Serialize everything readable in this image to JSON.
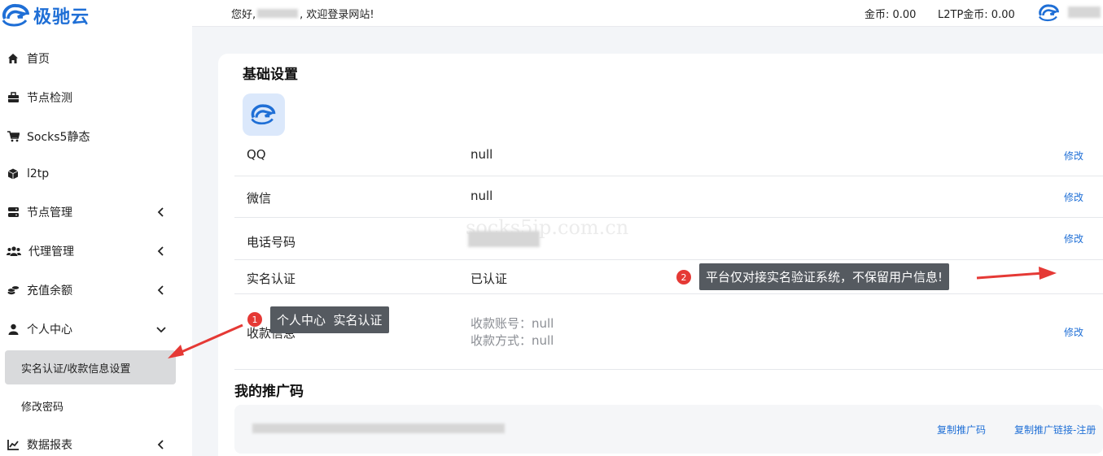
{
  "brand": {
    "name": "极驰云",
    "accent": "#1f6fd6"
  },
  "header": {
    "greeting_prefix": "您好,",
    "greeting_suffix": ", 欢迎登录网站!",
    "gold_label": "金币: 0.00",
    "l2tp_gold_label": "L2TP金币: 0.00"
  },
  "sidebar": {
    "items": [
      {
        "label": "首页",
        "icon": "home-icon"
      },
      {
        "label": "节点检测",
        "icon": "briefcase-icon"
      },
      {
        "label": "Socks5静态",
        "icon": "cart-icon"
      },
      {
        "label": "l2tp",
        "icon": "cube-icon"
      },
      {
        "label": "节点管理",
        "icon": "server-icon"
      },
      {
        "label": "代理管理",
        "icon": "users-icon"
      },
      {
        "label": "充值余额",
        "icon": "coins-icon"
      },
      {
        "label": "个人中心",
        "icon": "user-icon"
      },
      {
        "label": "数据报表",
        "icon": "chart-icon"
      }
    ],
    "sub_items": [
      {
        "label": "实名认证/收款信息设置",
        "active": true
      },
      {
        "label": "修改密码",
        "active": false
      }
    ]
  },
  "main": {
    "basic_title": "基础设置",
    "rows": [
      {
        "label": "QQ",
        "value": "null",
        "action": "修改"
      },
      {
        "label": "微信",
        "value": "null",
        "action": "修改"
      },
      {
        "label": "电话号码",
        "value": "",
        "action": "修改"
      },
      {
        "label": "实名认证",
        "value": "已认证",
        "action": ""
      }
    ],
    "payment": {
      "label": "收款信息",
      "account": "收款账号：null",
      "method": "收款方式：null",
      "action": "修改"
    },
    "promo_title": "我的推广码",
    "copy_code": "复制推广码",
    "copy_link": "复制推广链接-注册"
  },
  "watermark": "socks5ip.com.cn",
  "annotations": [
    {
      "number": "1",
      "text": "个人中心  实名认证"
    },
    {
      "number": "2",
      "text": "平台仅对接实名验证系统，不保留用户信息!"
    }
  ]
}
